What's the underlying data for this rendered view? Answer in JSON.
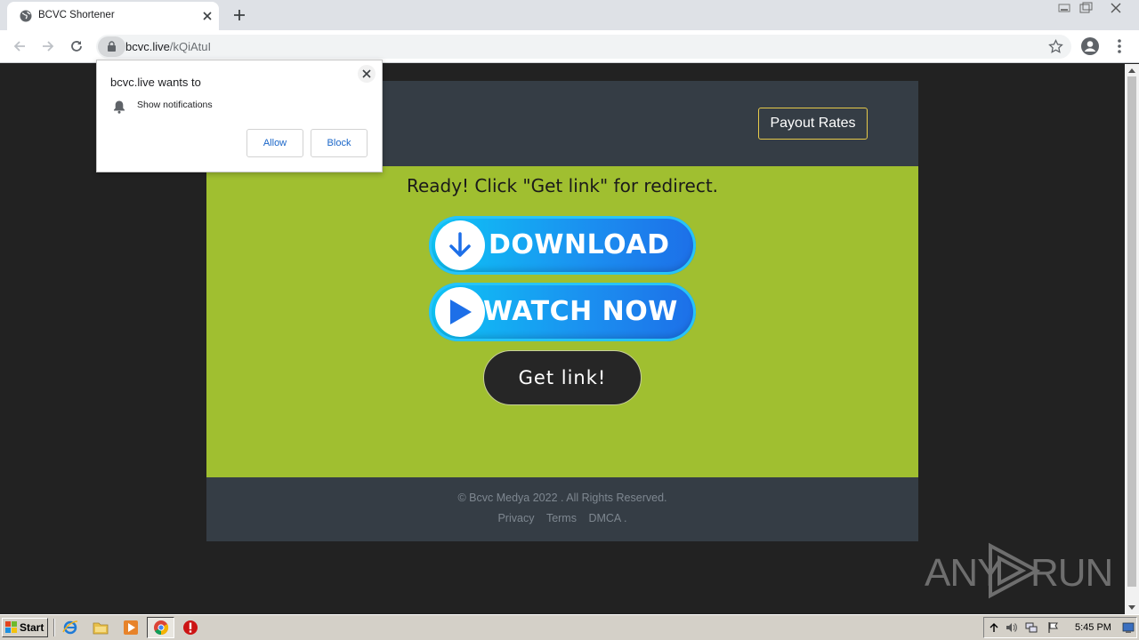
{
  "browser": {
    "tab_title": "BCVC Shortener",
    "url_host": "bcvc.live",
    "url_path": "/kQiAtuI"
  },
  "site": {
    "payout_label": "Payout Rates",
    "ready_text": "Ready! Click \"Get link\" for redirect.",
    "download_label": "DOWNLOAD",
    "watch_label": "WATCH NOW",
    "getlink_label": "Get link!",
    "copyright": "© Bcvc Medya 2022 . All Rights Reserved.",
    "footer_links": [
      "Privacy",
      "Terms",
      "DMCA ."
    ]
  },
  "permission_popup": {
    "title": "bcvc.live wants to",
    "item": "Show notifications",
    "allow_label": "Allow",
    "block_label": "Block"
  },
  "watermark": {
    "left": "ANY",
    "right": "RUN"
  },
  "taskbar": {
    "start_label": "Start",
    "clock": "5:45 PM"
  },
  "colors": {
    "header_footer_bg": "#353d45",
    "main_bg": "#a0bf30",
    "page_bg": "#222222",
    "payout_border": "#e6c94a",
    "promo_blue": "#1b8ff0",
    "getlink_bg": "#262626"
  },
  "icons": [
    "globe-icon",
    "close-icon",
    "plus-icon",
    "back-arrow-icon",
    "forward-arrow-icon",
    "reload-icon",
    "lock-icon",
    "star-icon",
    "profile-icon",
    "menu-icon",
    "download-arrow-icon",
    "play-icon",
    "bell-icon"
  ]
}
